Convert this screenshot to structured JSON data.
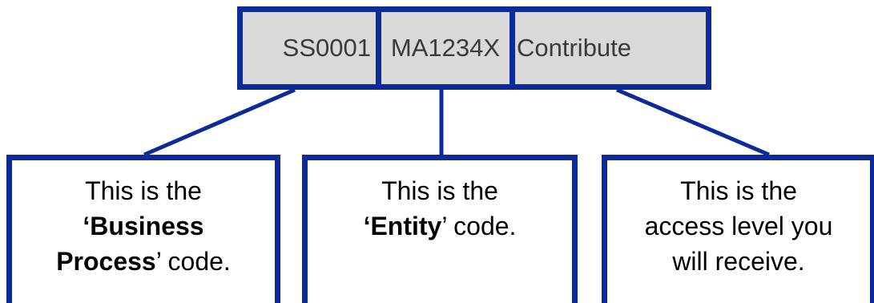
{
  "code_bar": {
    "segments": [
      "SS0001",
      "MA1234X",
      "Contribute"
    ]
  },
  "boxes": [
    {
      "line1": "This is the",
      "line2_bold": "‘Business",
      "line3_bold": "Process",
      "line3_rest": "’ code."
    },
    {
      "line1": "This is the",
      "line2_bold": "‘Entity",
      "line2_rest": "’ code."
    },
    {
      "line1": "This is the",
      "line2": "access level you",
      "line3": "will receive."
    }
  ],
  "colors": {
    "accent": "#0d2a9a",
    "code_fill": "#d9d9d9"
  }
}
